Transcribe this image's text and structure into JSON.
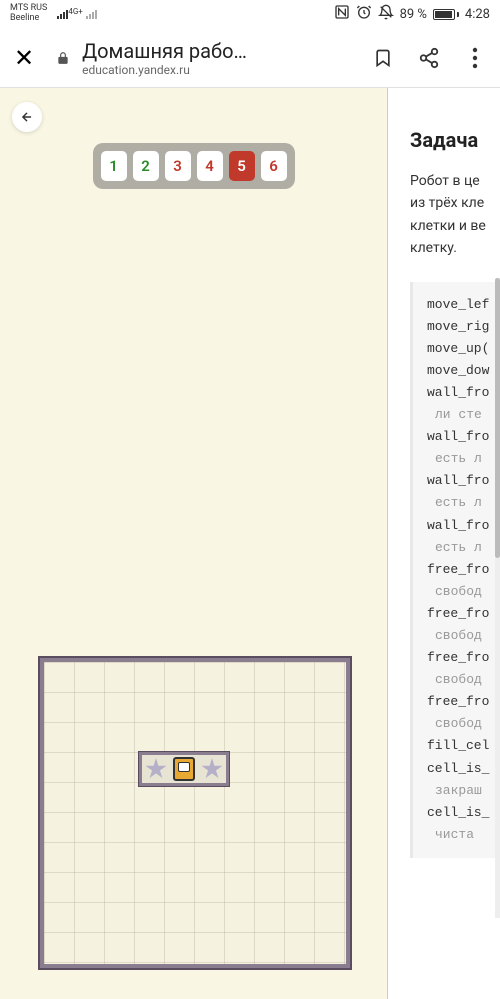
{
  "status": {
    "carrier1": "MTS RUS",
    "carrier2": "Beeline",
    "net": "4G+",
    "battery_pct": "89 %",
    "time": "4:28"
  },
  "browser": {
    "title": "Домашняя рабо…",
    "domain": "education.yandex.ru"
  },
  "tasks": {
    "items": [
      {
        "label": "1",
        "state": "ok"
      },
      {
        "label": "2",
        "state": "ok"
      },
      {
        "label": "3",
        "state": "danger"
      },
      {
        "label": "4",
        "state": "danger"
      },
      {
        "label": "5",
        "state": "active"
      },
      {
        "label": "6",
        "state": "danger"
      }
    ]
  },
  "right": {
    "title": "Задача ",
    "desc_l1": "Робот в це",
    "desc_l2": "из трёх кле",
    "desc_l3": "клетки и ве",
    "desc_l4": "клетку.",
    "code": [
      {
        "t": "cmd",
        "v": "move_lef"
      },
      {
        "t": "cmd",
        "v": "move_rig"
      },
      {
        "t": "cmd",
        "v": "move_up("
      },
      {
        "t": "cmd",
        "v": "move_dow"
      },
      {
        "t": "cmd",
        "v": "wall_fro"
      },
      {
        "t": "comment",
        "v": "ли сте"
      },
      {
        "t": "cmd",
        "v": "wall_fro"
      },
      {
        "t": "comment",
        "v": "есть л"
      },
      {
        "t": "cmd",
        "v": "wall_fro"
      },
      {
        "t": "comment",
        "v": "есть л"
      },
      {
        "t": "cmd",
        "v": "wall_fro"
      },
      {
        "t": "comment",
        "v": "есть л"
      },
      {
        "t": "cmd",
        "v": "free_fro"
      },
      {
        "t": "comment",
        "v": "свобод"
      },
      {
        "t": "cmd",
        "v": "free_fro"
      },
      {
        "t": "comment",
        "v": "свобод"
      },
      {
        "t": "cmd",
        "v": "free_fro"
      },
      {
        "t": "comment",
        "v": "свобод"
      },
      {
        "t": "cmd",
        "v": "free_fro"
      },
      {
        "t": "comment",
        "v": "свобод"
      },
      {
        "t": "cmd",
        "v": "fill_cel"
      },
      {
        "t": "cmd",
        "v": "cell_is_"
      },
      {
        "t": "comment",
        "v": "закраш"
      },
      {
        "t": "cmd",
        "v": "cell_is_"
      },
      {
        "t": "comment",
        "v": "чиста"
      }
    ]
  }
}
